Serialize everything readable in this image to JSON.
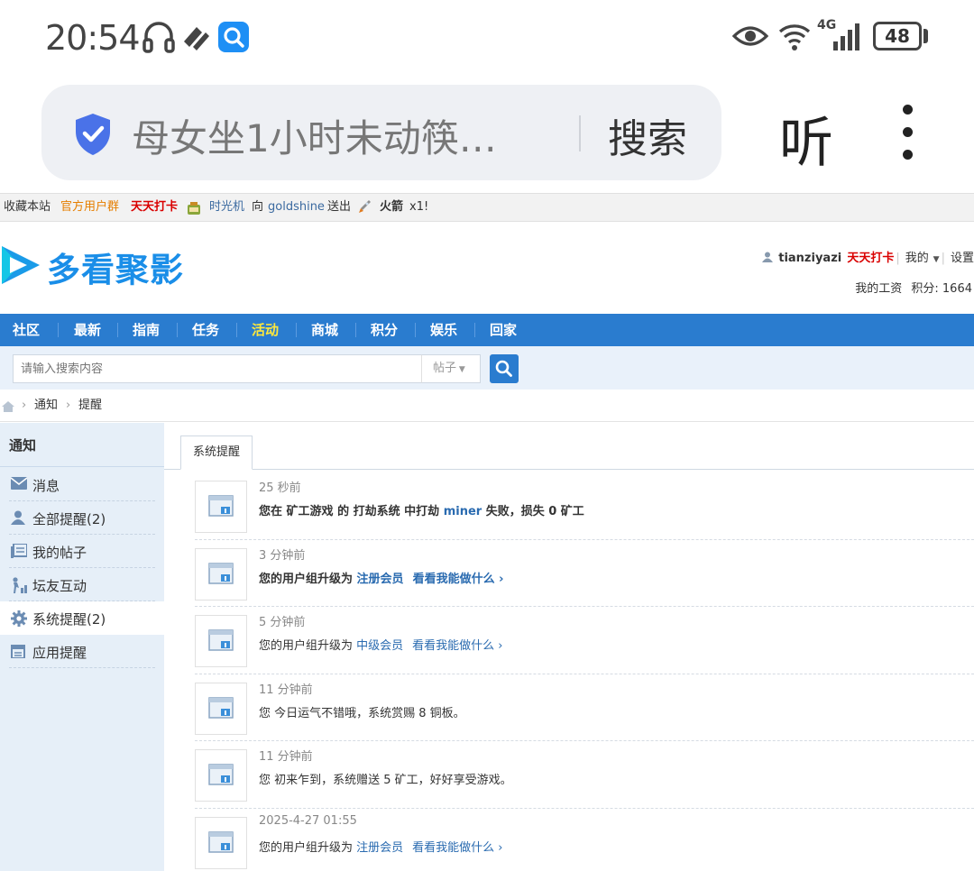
{
  "status": {
    "time": "20:54",
    "network": "4G",
    "battery": "48"
  },
  "browser": {
    "address_text": "母女坐1小时未动筷…",
    "search_label": "搜索",
    "listen_label": "听"
  },
  "toolbar": {
    "bookmark": "收藏本站",
    "official_group": "官方用户群",
    "daily_checkin": "天天打卡",
    "msg_timemachine": "时光机",
    "msg_to": "向",
    "msg_user": "goldshine",
    "msg_sent": "送出",
    "msg_item": "火箭",
    "msg_count": "x1!"
  },
  "header": {
    "logo_text": "多看聚影",
    "username": "tianziyazi",
    "checkin": "天天打卡",
    "my_menu": "我的",
    "settings": "设置",
    "my_salary": "我的工资",
    "credits": "积分: 1664"
  },
  "nav": {
    "items": [
      "社区",
      "最新",
      "指南",
      "任务",
      "活动",
      "商城",
      "积分",
      "娱乐",
      "回家"
    ],
    "active": "活动"
  },
  "search": {
    "placeholder": "请输入搜索内容",
    "type": "帖子"
  },
  "breadcrumb": {
    "level1": "通知",
    "level2": "提醒"
  },
  "sidebar": {
    "title": "通知",
    "items": [
      {
        "label": "消息",
        "icon": "mail-icon"
      },
      {
        "label": "全部提醒(2)",
        "icon": "user-icon"
      },
      {
        "label": "我的帖子",
        "icon": "posts-icon"
      },
      {
        "label": "坛友互动",
        "icon": "interaction-icon"
      },
      {
        "label": "系统提醒(2)",
        "icon": "gear-icon"
      },
      {
        "label": "应用提醒",
        "icon": "calendar-icon"
      }
    ],
    "active_index": 4
  },
  "tab": {
    "label": "系统提醒"
  },
  "notices": [
    {
      "time": "25 秒前",
      "p1": "您在 ",
      "p2": "矿工游戏",
      "p3": " 的 ",
      "p4": "打劫系统",
      "p5": " 中打劫 ",
      "p6": "miner",
      "p7": " 失败，损失 0 矿工"
    },
    {
      "time": "3 分钟前",
      "text": "您的用户组升级为",
      "group": "注册会员",
      "link": "看看我能做什么 ›"
    },
    {
      "time": "5 分钟前",
      "text": "您的用户组升级为",
      "group": "中级会员",
      "link": "看看我能做什么 ›"
    },
    {
      "time": "11 分钟前",
      "text": "您 今日运气不错哦，系统赏赐 8 铜板。"
    },
    {
      "time": "11 分钟前",
      "text": "您 初来乍到，系统赠送 5 矿工，好好享受游戏。"
    },
    {
      "time": "2025-4-27 01:55",
      "text": "您的用户组升级为",
      "group": "注册会员",
      "link": "看看我能做什么 ›"
    }
  ],
  "colors": {
    "nav_bg": "#2a7ccf",
    "nav_active": "#ffe93b",
    "sidebar_bg": "#e6eff8",
    "link": "#2a6bb0",
    "logo": "#1a8ee8"
  }
}
